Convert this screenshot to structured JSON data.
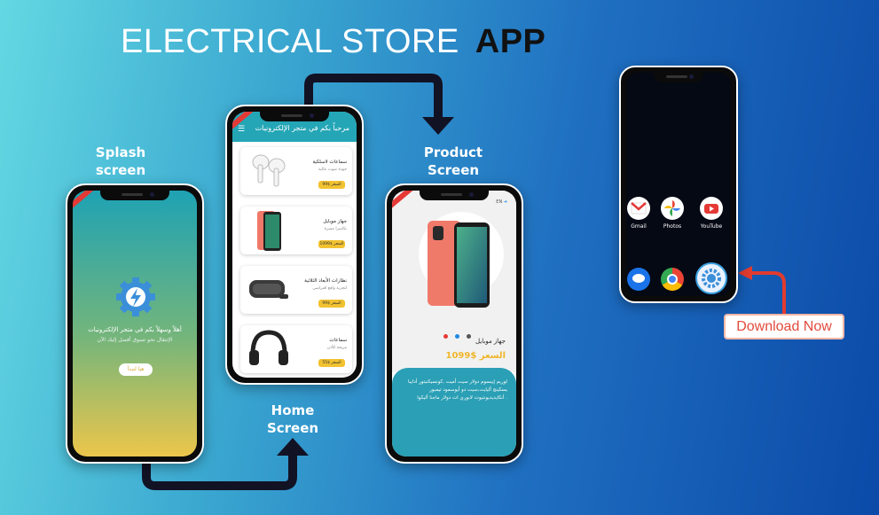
{
  "title": {
    "main": "ELECTRICAL STORE",
    "accent": "APP"
  },
  "labels": {
    "splash": [
      "Splash",
      "screen"
    ],
    "home": [
      "Home",
      "Screen"
    ],
    "product": [
      "Product",
      "Screen"
    ]
  },
  "splash": {
    "welcome": "أهلاً وسهلاً بكم في متجر الإلكترونيات",
    "subtitle": "الإنتقال نحو تسوق أفضل إليك الآن",
    "button": "هيا لنبدأ"
  },
  "home": {
    "header_title": "مرحباً بكم في متجر الإلكترونيات",
    "menu_icon": "menu-icon",
    "products": [
      {
        "name": "سماعات لاسلكية",
        "desc": "جودة صوت عالية",
        "price": "السعر $99"
      },
      {
        "name": "جهاز موبايل",
        "desc": "بكاميرا مميزة",
        "price": "السعر $1099"
      },
      {
        "name": "نظارات الأبعاد الثلاثية",
        "desc": "لتجربة واقع افتراضي",
        "price": "السعر $99"
      },
      {
        "name": "سماعات",
        "desc": "مريحة للأذن",
        "price": "السعر $55"
      }
    ]
  },
  "product": {
    "lang": "EN",
    "name": "جهاز موبايل",
    "price": "السعر $1099",
    "description": "لوريم إيبسوم دولار سيت أميت ,كونسيكتيتور أدايبا يسكينج أليايت,سيت دو أيوسمود تيمبور أنكايديديونتيوت لابوري ات دولار ماجنا أليكوا .",
    "dot_colors": [
      "#e53935",
      "#1e88e5",
      "#555555"
    ]
  },
  "device": {
    "apps_row1": [
      "Gmail",
      "Photos",
      "YouTube"
    ]
  },
  "download": "Download Now",
  "colors": {
    "accent_teal": "#24a6b6",
    "price_yellow": "#f2c230",
    "arrow_dark": "#121225",
    "arrow_red": "#e23b30"
  }
}
